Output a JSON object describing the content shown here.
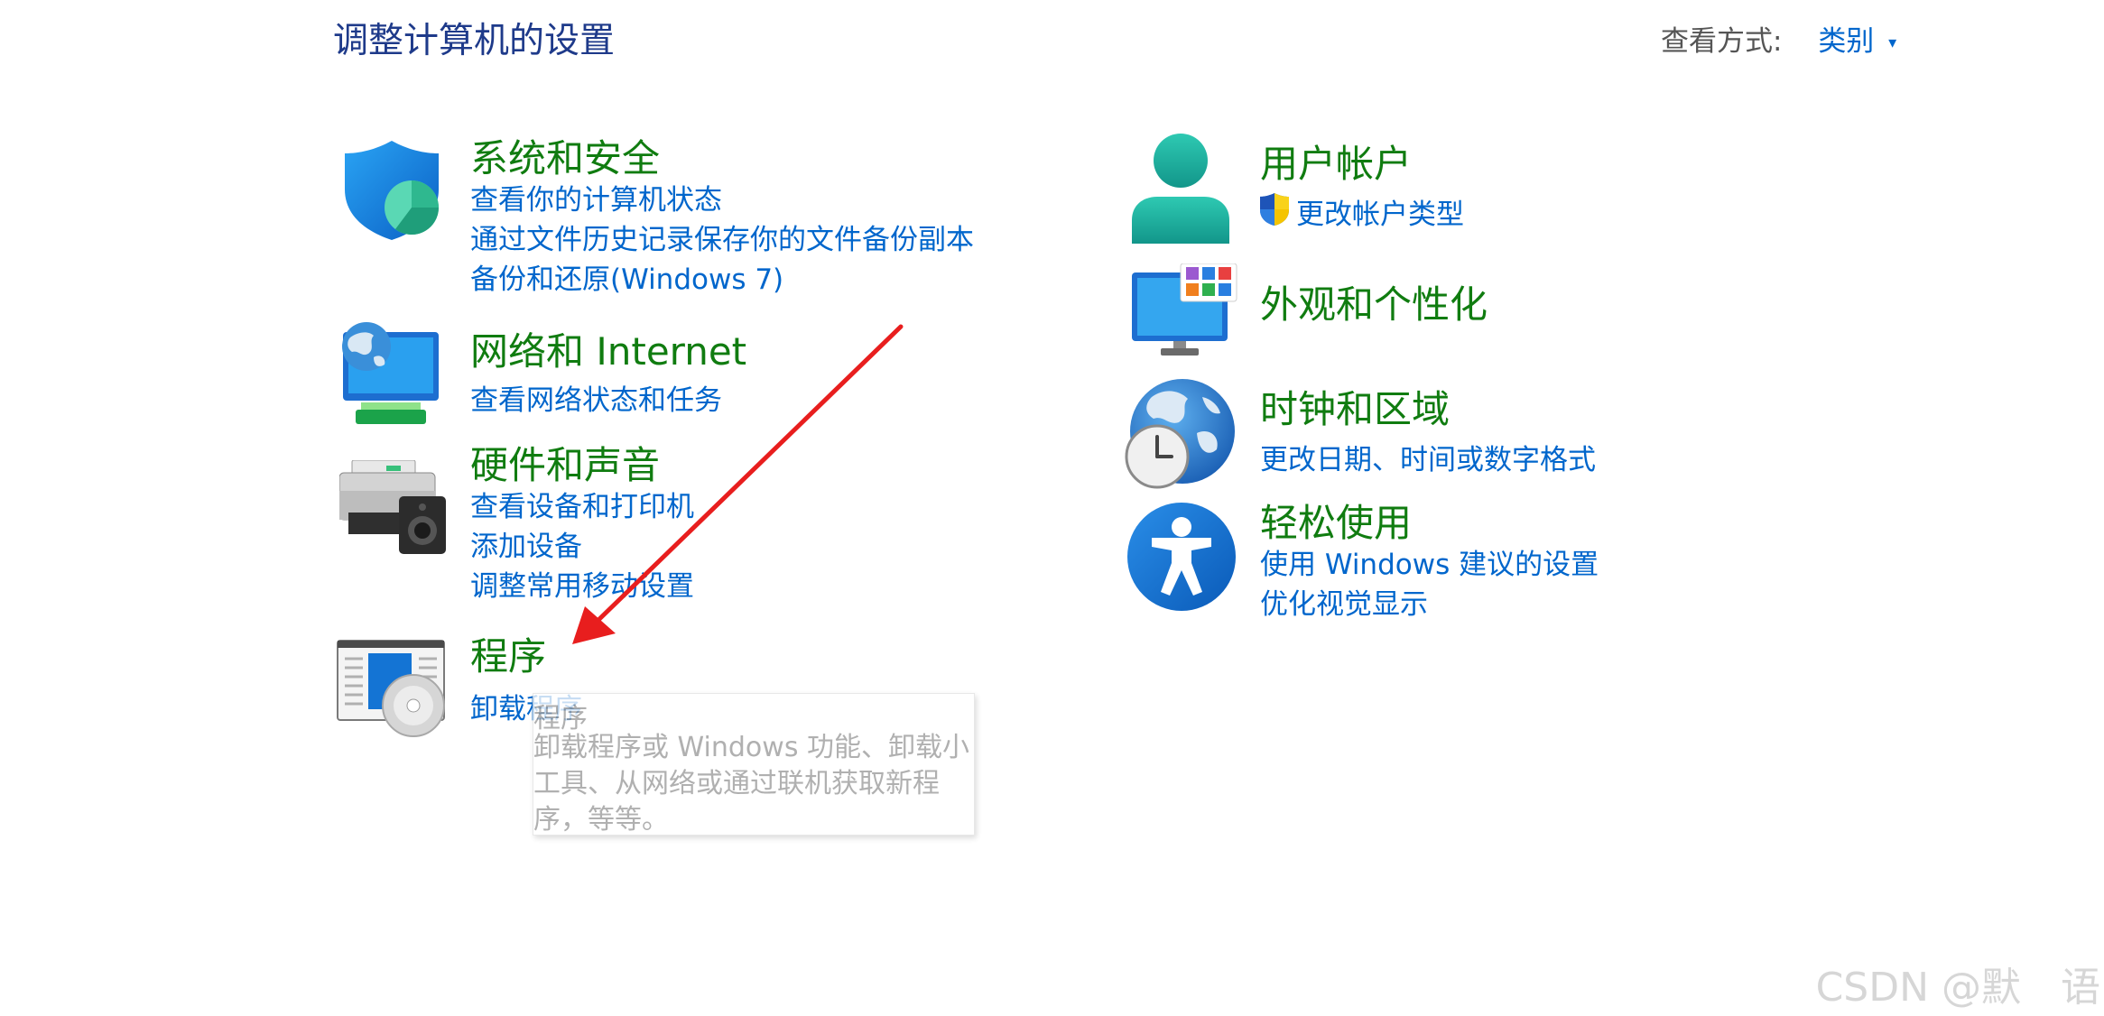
{
  "header": {
    "title": "调整计算机的设置",
    "view_by_label": "查看方式:",
    "view_by_value": "类别"
  },
  "categories": {
    "system_security": {
      "title": "系统和安全",
      "links": [
        "查看你的计算机状态",
        "通过文件历史记录保存你的文件备份副本",
        "备份和还原(Windows 7)"
      ]
    },
    "network": {
      "title": "网络和 Internet",
      "links": [
        "查看网络状态和任务"
      ]
    },
    "hardware": {
      "title": "硬件和声音",
      "links": [
        "查看设备和打印机",
        "添加设备",
        "调整常用移动设置"
      ]
    },
    "programs": {
      "title": "程序",
      "links": [
        "卸载程序"
      ]
    },
    "user_accounts": {
      "title": "用户帐户",
      "links": [
        "更改帐户类型"
      ]
    },
    "appearance": {
      "title": "外观和个性化",
      "links": []
    },
    "clock_region": {
      "title": "时钟和区域",
      "links": [
        "更改日期、时间或数字格式"
      ]
    },
    "ease_of_access": {
      "title": "轻松使用",
      "links": [
        "使用 Windows 建议的设置",
        "优化视觉显示"
      ]
    }
  },
  "tooltip": {
    "title": "程序",
    "body": "卸载程序或 Windows 功能、卸载小工具、从网络或通过联机获取新程序，等等。"
  },
  "watermark": "CSDN @默　语",
  "colors": {
    "title_blue": "#1e3a8a",
    "category_green": "#107c10",
    "link_blue": "#0066cc",
    "arrow_red": "#e81e1e"
  },
  "icons": {
    "system_security": "shield-icon",
    "network": "network-globe-icon",
    "hardware": "printer-speaker-icon",
    "programs": "program-disc-icon",
    "user_accounts": "user-icon",
    "appearance": "monitor-palette-icon",
    "clock_region": "globe-clock-icon",
    "ease_of_access": "accessibility-icon"
  }
}
